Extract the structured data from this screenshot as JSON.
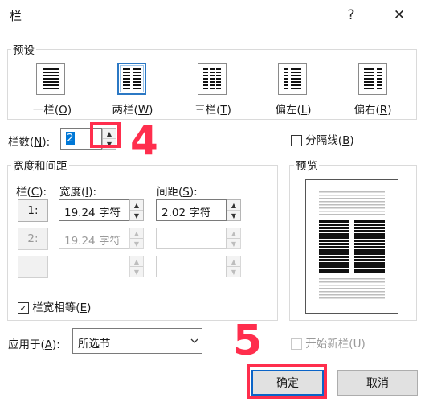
{
  "dialog": {
    "title": "栏",
    "help_glyph": "?",
    "close_glyph": "✕"
  },
  "presets": {
    "group_label": "预设",
    "items": [
      {
        "label_pre": "一栏(",
        "key": "O",
        "label_post": ")"
      },
      {
        "label_pre": "两栏(",
        "key": "W",
        "label_post": ")"
      },
      {
        "label_pre": "三栏(",
        "key": "T",
        "label_post": ")"
      },
      {
        "label_pre": "偏左(",
        "key": "L",
        "label_post": ")"
      },
      {
        "label_pre": "偏右(",
        "key": "R",
        "label_post": ")"
      }
    ],
    "selected_index": 1
  },
  "column_count": {
    "label_pre": "栏数(",
    "key": "N",
    "label_post": "):",
    "value": "2"
  },
  "separator": {
    "label_pre": "分隔线(",
    "key": "B",
    "label_post": ")",
    "checked": false
  },
  "width_spacing": {
    "group_label": "宽度和间距",
    "col_header_pre": "栏(",
    "col_header_key": "C",
    "col_header_post": "):",
    "width_header_pre": "宽度(",
    "width_header_key": "I",
    "width_header_post": "):",
    "spacing_header_pre": "间距(",
    "spacing_header_key": "S",
    "spacing_header_post": "):",
    "rows": [
      {
        "col": "1:",
        "width": "19.24 字符",
        "spacing": "2.02 字符",
        "enabled": true
      },
      {
        "col": "2:",
        "width": "19.24 字符",
        "spacing": "",
        "enabled": false
      },
      {
        "col": "",
        "width": "",
        "spacing": "",
        "enabled": false
      }
    ]
  },
  "equal_width": {
    "label_pre": "栏宽相等(",
    "key": "E",
    "label_post": ")",
    "checked": true
  },
  "preview": {
    "group_label": "预览"
  },
  "apply_to": {
    "label_pre": "应用于(",
    "key": "A",
    "label_post": "):",
    "value": "所选节"
  },
  "new_column": {
    "label_pre": "开始新栏(",
    "key": "U",
    "label_post": ")",
    "checked": false,
    "enabled": false
  },
  "buttons": {
    "ok": "确定",
    "cancel": "取消"
  },
  "annotations": {
    "step4": "4",
    "step5": "5"
  },
  "colors": {
    "accent": "#0a64c8",
    "annotation": "#ff2e4d"
  }
}
